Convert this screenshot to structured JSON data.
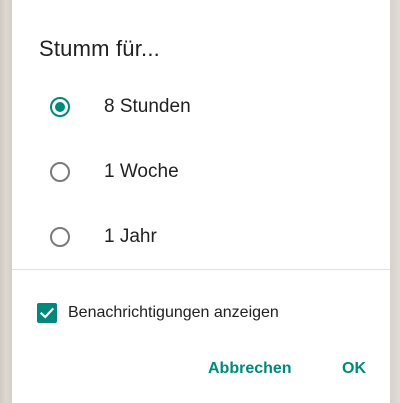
{
  "dialog": {
    "title": "Stumm für...",
    "options": [
      {
        "label": "8 Stunden",
        "selected": true
      },
      {
        "label": "1 Woche",
        "selected": false
      },
      {
        "label": "1 Jahr",
        "selected": false
      }
    ],
    "checkbox": {
      "label": "Benachrichtigungen anzeigen",
      "checked": true
    },
    "buttons": {
      "cancel": "Abbrechen",
      "ok": "OK"
    }
  },
  "colors": {
    "accent": "#00897b",
    "text": "#212121",
    "radio_unselected": "#7a7a7a"
  }
}
